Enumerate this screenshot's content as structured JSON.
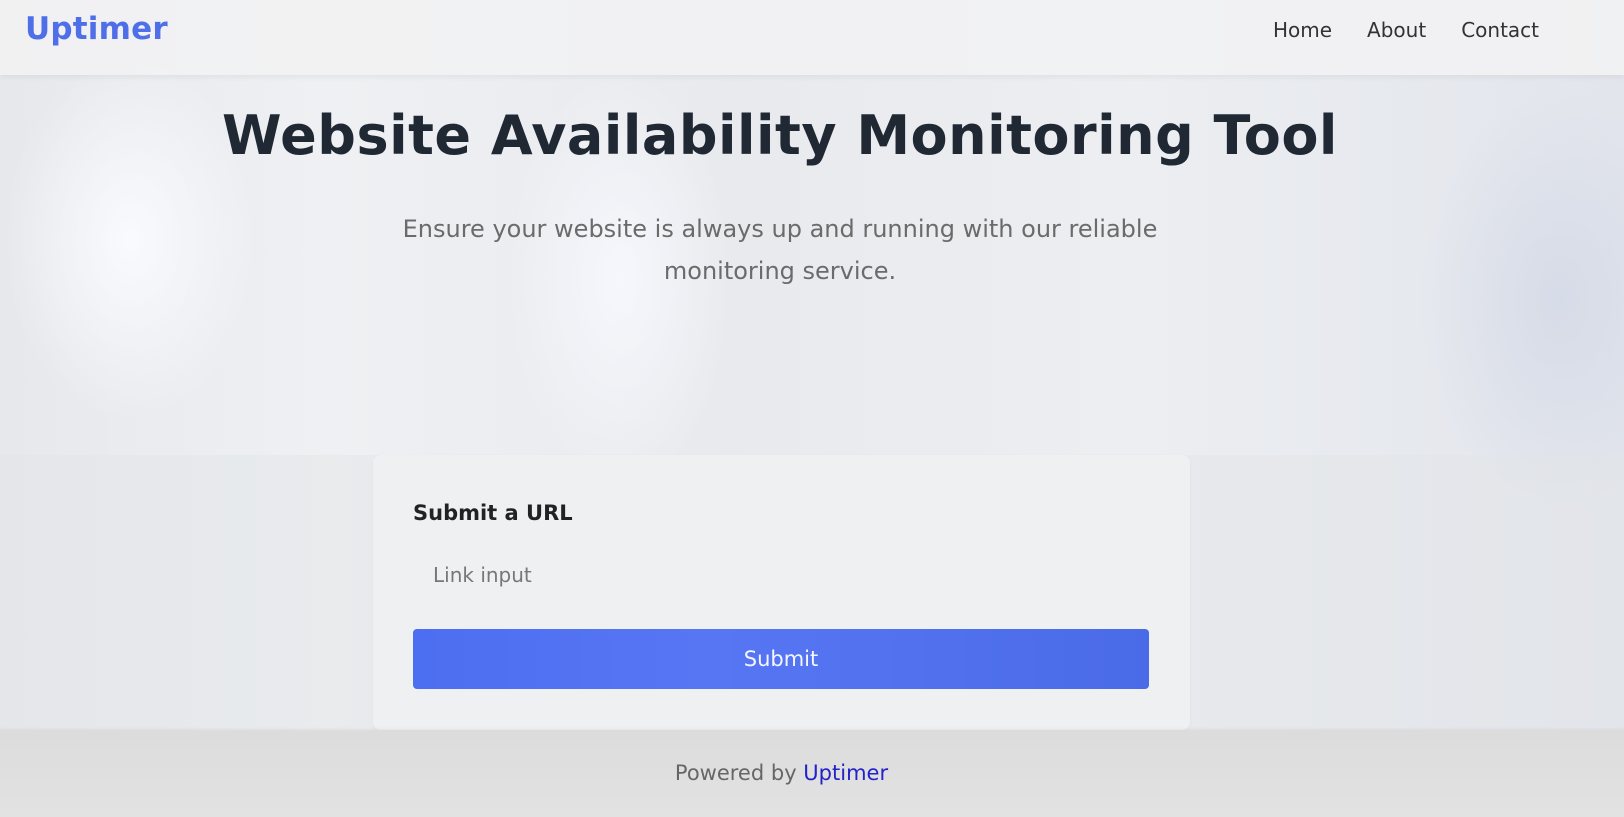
{
  "header": {
    "logo": "Uptimer",
    "nav": {
      "home": "Home",
      "about": "About",
      "contact": "Contact"
    }
  },
  "hero": {
    "title": "Website Availability Monitoring Tool",
    "subtitle": "Ensure your website is always up and running with our reliable monitoring service."
  },
  "form": {
    "label": "Submit a URL",
    "input_placeholder": "Link input",
    "input_value": "",
    "submit_label": "Submit"
  },
  "footer": {
    "prefix": "Powered by ",
    "link": "Uptimer"
  },
  "colors": {
    "accent": "#4f6fe8",
    "button": "#4c6ef0",
    "title": "#1f2833",
    "footer_link": "#2323c8"
  }
}
